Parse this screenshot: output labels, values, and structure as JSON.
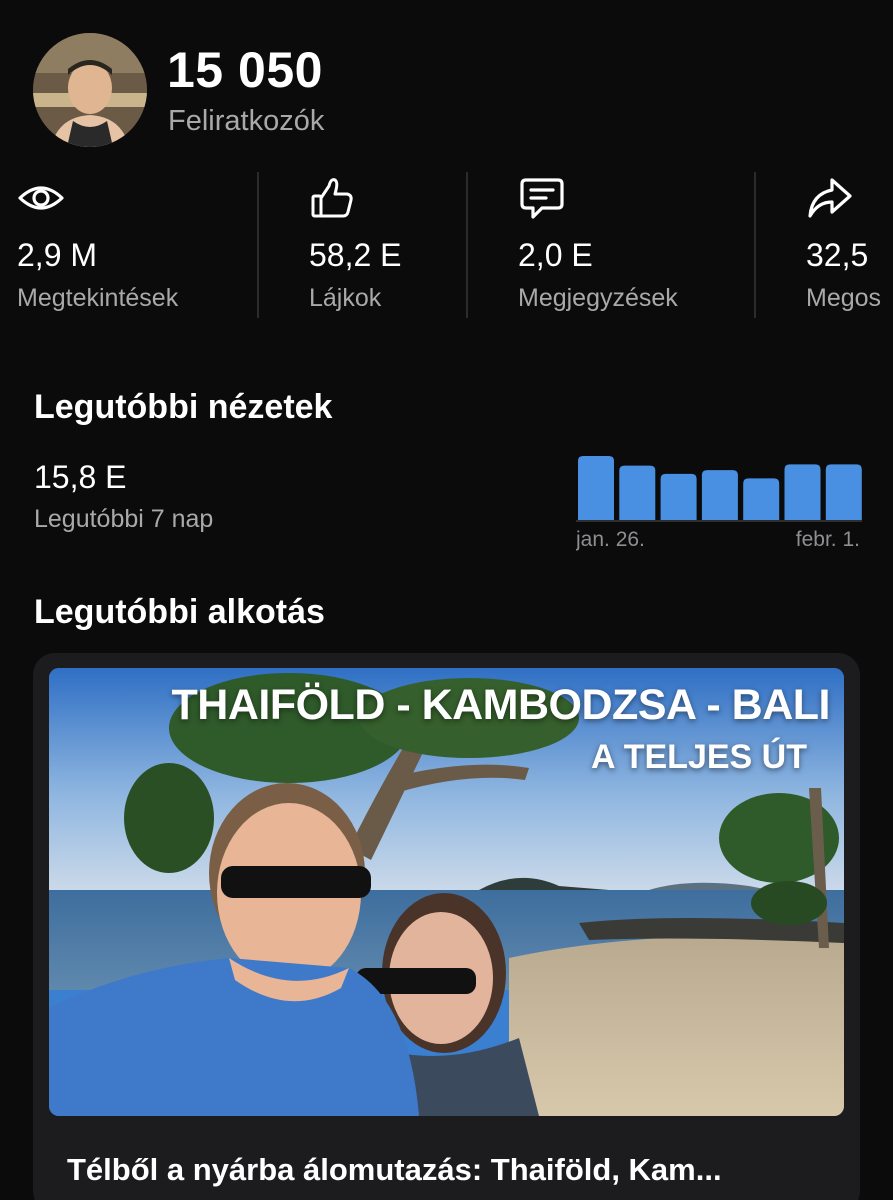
{
  "channel": {
    "subscriber_count": "15 050",
    "subscriber_label": "Feliratkozók",
    "avatar_icon": "profile-photo"
  },
  "stats": [
    {
      "icon": "eye-icon",
      "value": "2,9 M",
      "label": "Megtekintések"
    },
    {
      "icon": "thumbs-up-icon",
      "value": "58,2 E",
      "label": "Lájkok"
    },
    {
      "icon": "comment-icon",
      "value": "2,0 E",
      "label": "Megjegyzések"
    },
    {
      "icon": "share-icon",
      "value": "32,5",
      "label": "Megos"
    }
  ],
  "recent_views": {
    "title": "Legutóbbi nézetek",
    "value": "15,8 E",
    "period_label": "Legutóbbi 7 nap",
    "chart_start_label": "jan. 26.",
    "chart_end_label": "febr. 1.",
    "bar_color": "#4a90e2",
    "bar_levels": [
      1.0,
      0.85,
      0.72,
      0.78,
      0.65,
      0.87,
      0.87
    ]
  },
  "latest_creation": {
    "title": "Legutóbbi alkotás",
    "thumbnail_title_line1": "THAIFÖLD - KAMBODZSA - BALI",
    "thumbnail_title_line2": "A TELJES ÚT",
    "video_title": "Télből a nyárba álomutazás: Thaiföld, Kam..."
  },
  "colors": {
    "background": "#0b0b0b",
    "card": "#1c1c1e",
    "secondary_text": "#a9a9a9",
    "accent": "#4a90e2"
  }
}
